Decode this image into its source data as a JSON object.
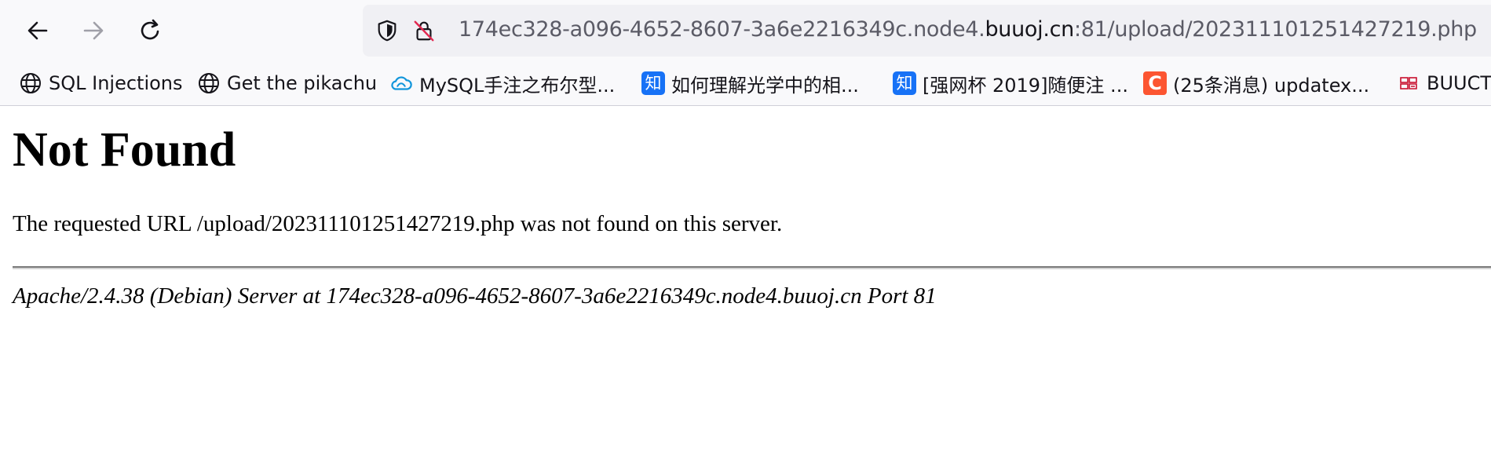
{
  "browser": {
    "url": {
      "prefix": "174ec328-a096-4652-8607-3a6e2216349c.node4.",
      "domain": "buuoj.cn",
      "suffix": ":81/upload/202311101251427219.php"
    },
    "icons": {
      "back": "arrow-left-icon",
      "forward": "arrow-right-icon",
      "reload": "reload-icon",
      "tracking_protection": "shield-icon",
      "connection": "insecure-lock-icon"
    }
  },
  "bookmarks": [
    {
      "label": "SQL Injections",
      "icon": "globe-icon"
    },
    {
      "label": "Get the pikachu",
      "icon": "globe-icon"
    },
    {
      "label": "MySQL手注之布尔型...",
      "icon": "cloud-icon"
    },
    {
      "label": "如何理解光学中的相...",
      "icon": "zhihu-icon",
      "icon_text": "知"
    },
    {
      "label": "[强网杯 2019]随便注 ...",
      "icon": "zhihu-icon",
      "icon_text": "知"
    },
    {
      "label": "(25条消息) updatex...",
      "icon": "csdn-icon",
      "icon_text": "C"
    },
    {
      "label": "BUUCT",
      "icon": "buuctf-logo-icon"
    }
  ],
  "page": {
    "heading": "Not Found",
    "message": "The requested URL /upload/202311101251427219.php was not found on this server.",
    "server_signature": "Apache/2.4.38 (Debian) Server at 174ec328-a096-4652-8607-3a6e2216349c.node4.buuoj.cn Port 81"
  },
  "colors": {
    "toolbar_bg": "#f9f9fb",
    "urlbar_bg": "#f0f0f4",
    "zhihu_blue": "#1772f6",
    "csdn_red": "#fc5531"
  }
}
